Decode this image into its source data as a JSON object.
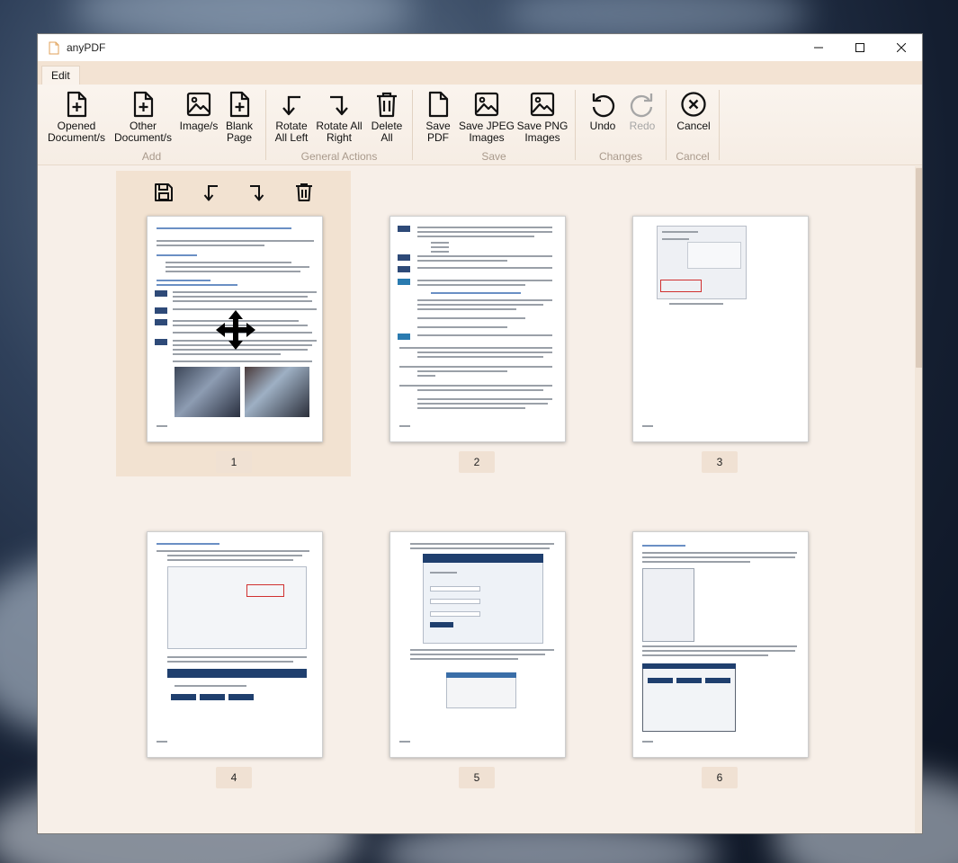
{
  "window": {
    "title": "anyPDF"
  },
  "tabs": [
    {
      "label": "Edit"
    }
  ],
  "ribbon": {
    "groups": [
      {
        "label": "Add",
        "buttons": [
          {
            "label": "Opened\nDocument/s",
            "icon": "file-plus-icon"
          },
          {
            "label": "Other\nDocument/s",
            "icon": "file-plus-icon"
          },
          {
            "label": "Image/s",
            "icon": "image-icon"
          },
          {
            "label": "Blank\nPage",
            "icon": "file-plus-icon"
          }
        ]
      },
      {
        "label": "General Actions",
        "buttons": [
          {
            "label": "Rotate\nAll Left",
            "icon": "rotate-left-icon"
          },
          {
            "label": "Rotate All\nRight",
            "icon": "rotate-right-icon"
          },
          {
            "label": "Delete\nAll",
            "icon": "trash-icon"
          }
        ]
      },
      {
        "label": "Save",
        "buttons": [
          {
            "label": "Save\nPDF",
            "icon": "file-icon"
          },
          {
            "label": "Save JPEG\nImages",
            "icon": "image-icon"
          },
          {
            "label": "Save PNG\nImages",
            "icon": "image-icon"
          }
        ]
      },
      {
        "label": "Changes",
        "buttons": [
          {
            "label": "Undo",
            "icon": "undo-icon"
          },
          {
            "label": "Redo",
            "icon": "redo-icon",
            "disabled": true
          }
        ]
      },
      {
        "label": "Cancel",
        "buttons": [
          {
            "label": "Cancel",
            "icon": "cancel-circle-icon"
          }
        ]
      }
    ]
  },
  "pages": [
    {
      "number": "1",
      "selected": true
    },
    {
      "number": "2"
    },
    {
      "number": "3"
    },
    {
      "number": "4"
    },
    {
      "number": "5"
    },
    {
      "number": "6"
    }
  ],
  "selected_page_actions": [
    "save-icon",
    "rotate-left-icon",
    "rotate-right-icon",
    "trash-icon"
  ],
  "colors": {
    "accent_bg": "#f7efe8",
    "ribbon_bg": "#f3e3d3",
    "selected_bg": "#f2e2d1"
  }
}
